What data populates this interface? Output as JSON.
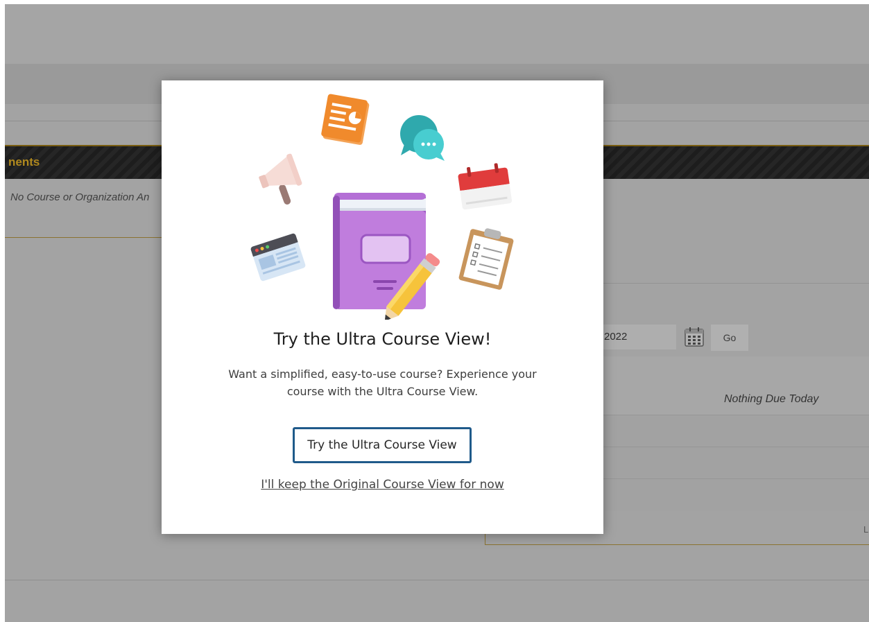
{
  "background": {
    "section_title": "nents",
    "announcements_message": "No Course or Organization An",
    "date_value": "2022",
    "go_label": "Go",
    "nothing_due": "Nothing Due Today",
    "edge_text": "L"
  },
  "modal": {
    "title": "Try the Ultra Course View!",
    "description": "Want a simplified, easy-to-use course? Experience your course with the Ultra Course View.",
    "primary_button": "Try the Ultra Course View",
    "secondary_link": "I'll keep the Original Course View for now"
  },
  "icons": [
    "document-icon",
    "chat-bubbles-icon",
    "megaphone-icon",
    "calendar-icon",
    "browser-window-icon",
    "clipboard-icon",
    "book-icon",
    "pencil-icon"
  ],
  "colors": {
    "overlay_bg": "#a3a3a3",
    "header_bar": "#1d1d1d",
    "gold_accent": "#b0891e",
    "button_border": "#1f5a8a",
    "book_purple": "#b46fd6",
    "doc_orange": "#f08a2c",
    "chat_teal": "#3bbfc3",
    "calendar_red": "#e03c3c",
    "pencil_yellow": "#f6c33b"
  }
}
